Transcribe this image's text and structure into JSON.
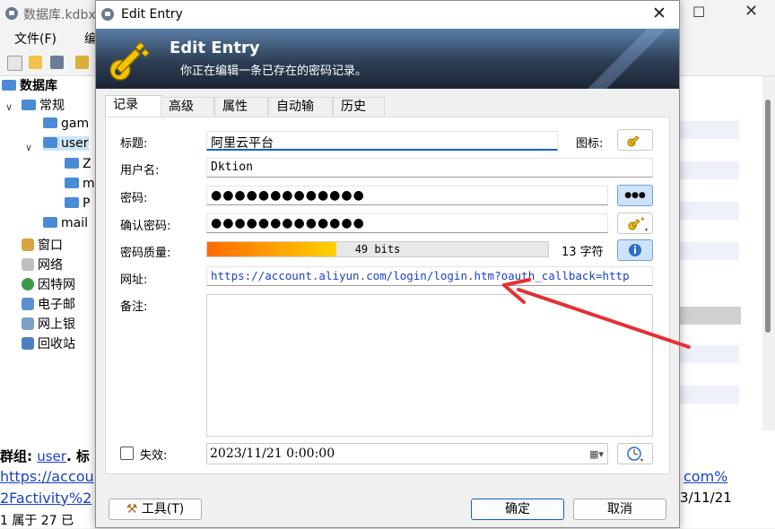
{
  "background": {
    "title": "数据库.kdbx",
    "menu_file": "文件(F)",
    "menu_2": "编",
    "tree": {
      "root": "数据库",
      "general": "常规",
      "games": "gam",
      "user": "user",
      "sub1": "Z",
      "sub2": "m",
      "sub3": "P",
      "mail": "mail",
      "windows": "窗口",
      "network": "网络",
      "internet": "因特网",
      "email": "电子邮",
      "banking": "网上银",
      "recycle": "回收站"
    },
    "group_label": "群组:",
    "group_link": "user",
    "group_tail": ". 标",
    "url_line1": "https://accou",
    "url_line2": "2Factivity%2",
    "url_tail": "com%",
    "date_tail": "3/11/21",
    "status_line": "1 属于 27 已"
  },
  "dialog": {
    "title": "Edit Entry",
    "heading": "Edit Entry",
    "subheading": "你正在编辑一条已存在的密码记录。",
    "tabs": [
      "记录",
      "高级",
      "属性",
      "自动输入",
      "历史"
    ],
    "labels": {
      "title": "标题:",
      "icon": "图标:",
      "username": "用户名:",
      "password": "密码:",
      "confirm": "确认密码:",
      "quality": "密码质量:",
      "url": "网址:",
      "notes": "备注:",
      "expires": "失效:"
    },
    "values": {
      "title": "阿里云平台",
      "username": "Dktion",
      "password": "●●●●●●●●●●●●●",
      "confirm": "●●●●●●●●●●●●●",
      "quality_bits": "49 bits",
      "quality_fraction": 0.38,
      "char_count": "13 字符",
      "url": "https://account.aliyun.com/login/login.htm?oauth_callback=http",
      "expiry": "2023/11/21   0:00:00"
    },
    "buttons": {
      "tools": "工具(T)",
      "ok": "确定",
      "cancel": "取消",
      "show_password": "●●●"
    }
  },
  "colors": {
    "annotation_arrow": "#e53030",
    "quality_start": "#ff6a00",
    "quality_end": "#ffd200",
    "link": "#1a3fc7"
  }
}
